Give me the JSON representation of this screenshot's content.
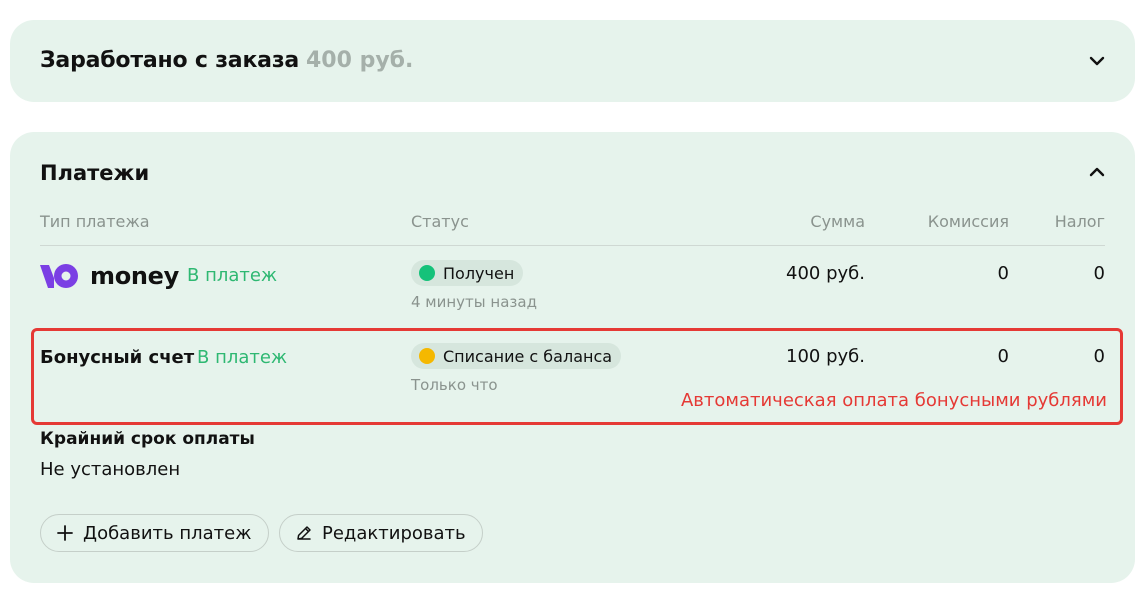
{
  "earned": {
    "title": "Заработано с заказа",
    "amount": "400 руб."
  },
  "payments": {
    "title": "Платежи",
    "columns": {
      "type": "Тип платежа",
      "status": "Статус",
      "sum": "Сумма",
      "fee": "Комиссия",
      "tax": "Налог"
    },
    "rows": [
      {
        "provider": "money",
        "link": "В платеж",
        "status": "Получен",
        "status_color": "#15c27a",
        "time": "4 минуты назад",
        "sum": "400 руб.",
        "fee": "0",
        "tax": "0"
      },
      {
        "provider": "Бонусный счет",
        "link": "В платеж",
        "status": "Списание с баланса",
        "status_color": "#f5b800",
        "time": "Только что",
        "sum": "100 руб.",
        "fee": "0",
        "tax": "0"
      }
    ],
    "annotation": "Автоматическая оплата бонусными рублями",
    "deadline_label": "Крайний срок оплаты",
    "deadline_value": "Не установлен",
    "buttons": {
      "add": "Добавить платеж",
      "edit": "Редактировать"
    }
  },
  "colors": {
    "card_bg": "#e6f3ec",
    "accent_green": "#2eb872",
    "highlight_red": "#e53935",
    "logo_purple": "#7b3fe4"
  },
  "icons": {
    "earned_toggle": "chevron-down-icon",
    "payments_toggle": "chevron-up-icon",
    "add": "plus-icon",
    "edit": "pencil-icon"
  }
}
